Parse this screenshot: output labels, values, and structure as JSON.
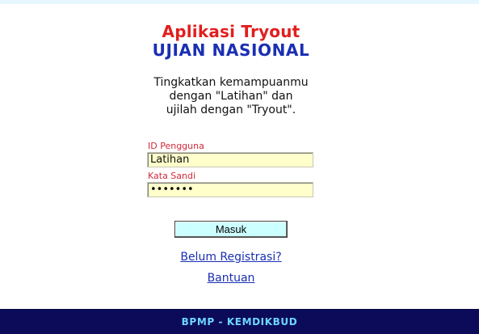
{
  "header": {
    "title": "Aplikasi Tryout",
    "subtitle": "UJIAN NASIONAL"
  },
  "tagline": {
    "line1": "Tingkatkan kemampuanmu",
    "line2": "dengan \"Latihan\" dan",
    "line3": "ujilah dengan \"Tryout\"."
  },
  "form": {
    "user_label": "ID Pengguna",
    "user_value": "Latihan",
    "pass_label": "Kata Sandi",
    "pass_value": "latihan",
    "submit_label": "Masuk"
  },
  "links": {
    "register": "Belum Registrasi?",
    "help": "Bantuan"
  },
  "footer": {
    "text": "BPMP - KEMDIKBUD"
  },
  "colors": {
    "title": "#e11f1f",
    "subtitle": "#1a2fb3",
    "label": "#d12a3a",
    "input_bg": "#ffffcc",
    "button_bg": "#ccffff",
    "footer_bg": "#0b0b5a",
    "footer_text": "#6ed6ff"
  }
}
